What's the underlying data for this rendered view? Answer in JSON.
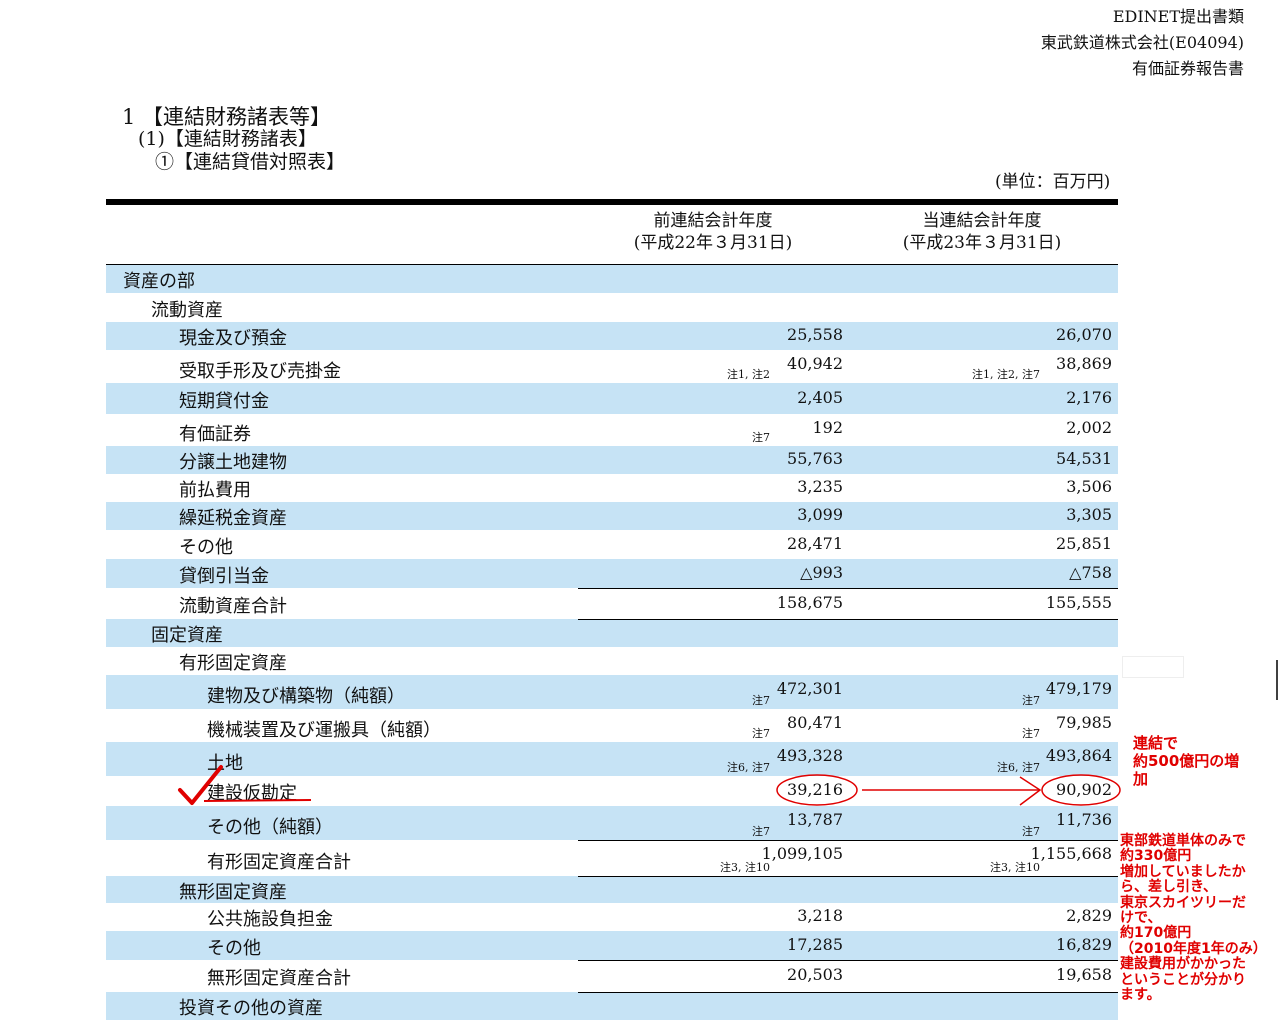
{
  "header": {
    "line1": "EDINET提出書類",
    "line2": "東武鉄道株式会社(E04094)",
    "line3": "有価証券報告書"
  },
  "sections": {
    "s1": "1 【連結財務諸表等】",
    "s2": "(1)【連結財務諸表】",
    "s3": "①【連結貸借対照表】"
  },
  "unit": "(単位：百万円)",
  "columns": {
    "prev_title": "前連結会計年度",
    "prev_date": "(平成22年３月31日)",
    "curr_title": "当連結会計年度",
    "curr_date": "(平成23年３月31日)"
  },
  "rows": [
    {
      "label": "資産の部",
      "prev": "",
      "curr": "",
      "prev_note": "",
      "curr_note": ""
    },
    {
      "label": "流動資産",
      "prev": "",
      "curr": "",
      "prev_note": "",
      "curr_note": ""
    },
    {
      "label": "現金及び預金",
      "prev": "25,558",
      "curr": "26,070",
      "prev_note": "",
      "curr_note": ""
    },
    {
      "label": "受取手形及び売掛金",
      "prev": "40,942",
      "curr": "38,869",
      "prev_note": "注1, 注2",
      "curr_note": "注1, 注2, 注7"
    },
    {
      "label": "短期貸付金",
      "prev": "2,405",
      "curr": "2,176",
      "prev_note": "",
      "curr_note": ""
    },
    {
      "label": "有価証券",
      "prev": "192",
      "curr": "2,002",
      "prev_note": "注7",
      "curr_note": ""
    },
    {
      "label": "分譲土地建物",
      "prev": "55,763",
      "curr": "54,531",
      "prev_note": "",
      "curr_note": ""
    },
    {
      "label": "前払費用",
      "prev": "3,235",
      "curr": "3,506",
      "prev_note": "",
      "curr_note": ""
    },
    {
      "label": "繰延税金資産",
      "prev": "3,099",
      "curr": "3,305",
      "prev_note": "",
      "curr_note": ""
    },
    {
      "label": "その他",
      "prev": "28,471",
      "curr": "25,851",
      "prev_note": "",
      "curr_note": ""
    },
    {
      "label": "貸倒引当金",
      "prev": "△993",
      "curr": "△758",
      "prev_note": "",
      "curr_note": ""
    },
    {
      "label": "流動資産合計",
      "prev": "158,675",
      "curr": "155,555",
      "prev_note": "",
      "curr_note": ""
    },
    {
      "label": "固定資産",
      "prev": "",
      "curr": "",
      "prev_note": "",
      "curr_note": ""
    },
    {
      "label": "有形固定資産",
      "prev": "",
      "curr": "",
      "prev_note": "",
      "curr_note": ""
    },
    {
      "label": "建物及び構築物（純額）",
      "prev": "472,301",
      "curr": "479,179",
      "prev_note": "注7",
      "curr_note": "注7"
    },
    {
      "label": "機械装置及び運搬具（純額）",
      "prev": "80,471",
      "curr": "79,985",
      "prev_note": "注7",
      "curr_note": "注7"
    },
    {
      "label": "土地",
      "prev": "493,328",
      "curr": "493,864",
      "prev_note": "注6, 注7",
      "curr_note": "注6, 注7"
    },
    {
      "label": "建設仮勘定",
      "prev": "39,216",
      "curr": "90,902",
      "prev_note": "",
      "curr_note": ""
    },
    {
      "label": "その他（純額）",
      "prev": "13,787",
      "curr": "11,736",
      "prev_note": "注7",
      "curr_note": "注7"
    },
    {
      "label": "有形固定資産合計",
      "prev": "1,099,105",
      "curr": "1,155,668",
      "prev_note": "注3, 注10",
      "curr_note": "注3, 注10"
    },
    {
      "label": "無形固定資産",
      "prev": "",
      "curr": "",
      "prev_note": "",
      "curr_note": ""
    },
    {
      "label": "公共施設負担金",
      "prev": "3,218",
      "curr": "2,829",
      "prev_note": "",
      "curr_note": ""
    },
    {
      "label": "その他",
      "prev": "17,285",
      "curr": "16,829",
      "prev_note": "",
      "curr_note": ""
    },
    {
      "label": "無形固定資産合計",
      "prev": "20,503",
      "curr": "19,658",
      "prev_note": "",
      "curr_note": ""
    },
    {
      "label": "投資その他の資産",
      "prev": "",
      "curr": "",
      "prev_note": "",
      "curr_note": ""
    }
  ],
  "annotations": {
    "consolidated": [
      "連結で",
      "約500億円の増",
      "加"
    ],
    "note": [
      "東部鉄道単体のみで",
      "約330億円",
      "増加していましたか",
      "ら、差し引き、",
      "東京スカイツリーだ",
      "けで、",
      "約170億円",
      "（2010年度1年のみ）",
      "建設費用がかかった",
      "ということが分かり",
      "ます。"
    ]
  },
  "colors": {
    "row_highlight": "#c6e3f5",
    "annotation_red": "#e00000"
  }
}
